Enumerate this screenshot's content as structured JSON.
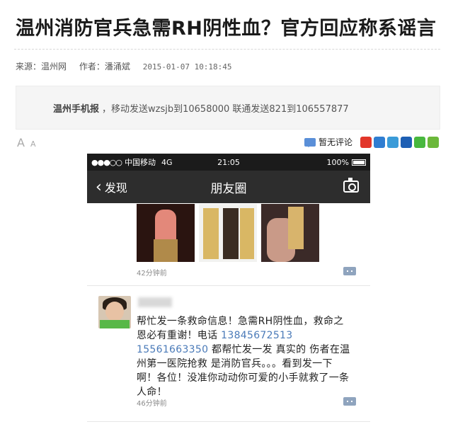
{
  "article": {
    "title": "温州消防官兵急需RH阴性血？官方回应称系谣言",
    "source_label": "来源：",
    "source": "温州网",
    "author_label": "作者：",
    "author": "潘涌斌",
    "timestamp": "2015-01-07 10:18:45"
  },
  "banner": {
    "brand": "温州手机报",
    "text": "，移动发送wzsjb到10658000 联通发送821到106557877"
  },
  "toolbar": {
    "font_large": "A",
    "font_small": "A",
    "comment_label": "暂无评论",
    "share_icons": [
      {
        "name": "weibo-icon",
        "color": "#e2362a"
      },
      {
        "name": "qzone-icon",
        "color": "#2f7dd1"
      },
      {
        "name": "tencent-weibo-icon",
        "color": "#3a9bd8"
      },
      {
        "name": "renren-icon",
        "color": "#1e5fb4"
      },
      {
        "name": "wechat-icon",
        "color": "#48b83e"
      },
      {
        "name": "more-share-icon",
        "color": "#6bb83a"
      }
    ]
  },
  "phone": {
    "status": {
      "signal": "●●●○○",
      "carrier": "中国移动",
      "network": "4G",
      "time": "21:05",
      "battery": "100%"
    },
    "nav": {
      "back_label": "发现",
      "title": "朋友圈"
    },
    "post1": {
      "time": "42分钟前"
    },
    "post2": {
      "text_a": "帮忙发一条救命信息！急需RH阴性血，救命之恩必有重谢！电话 ",
      "phone1": "13845672513",
      "phone2": "15561663350",
      "text_b": " 都帮忙发一发 真实的 伤者在温州第一医院抢救 是消防官兵。。。看到发一下啊！各位！没准你动动你可爱的小手就救了一条人命！",
      "time": "46分钟前"
    }
  }
}
